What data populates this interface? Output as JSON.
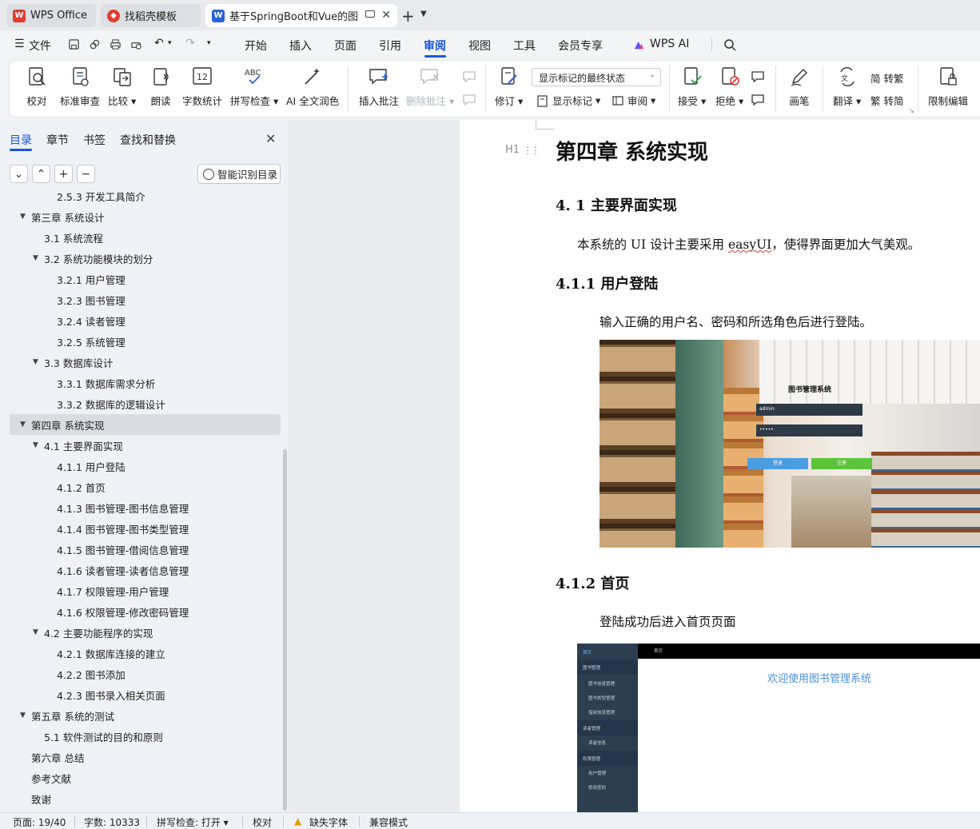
{
  "tabs": [
    {
      "label": "WPS Office"
    },
    {
      "label": "找稻壳模板"
    },
    {
      "label": "基于SpringBoot和Vue的图书"
    }
  ],
  "menu": {
    "file": "文件",
    "items": [
      "开始",
      "插入",
      "页面",
      "引用",
      "审阅",
      "视图",
      "工具",
      "会员专享"
    ],
    "active": "审阅",
    "ai": "WPS AI"
  },
  "ribbon": {
    "proofread": "校对",
    "standard_review": "标准审查",
    "compare": "比较",
    "read_aloud": "朗读",
    "word_count": "字数统计",
    "spell_check": "拼写检查",
    "ai_polish": "AI 全文润色",
    "insert_comment": "插入批注",
    "delete_comment": "删除批注",
    "revise": "修订",
    "view_mode": "显示标记的最终状态",
    "show_markup": "显示标记",
    "review_pane": "审阅",
    "accept": "接受",
    "reject": "拒绝",
    "pen": "画笔",
    "translate": "翻译",
    "to_traditional_a": "转繁",
    "to_simplified": "转简",
    "restrict_edit": "限制编辑",
    "word_count_icon_text": "12",
    "spell_icon_text": "ABC",
    "trad_a": "简",
    "trad_b": "繁"
  },
  "nav": {
    "tabs": [
      "目录",
      "章节",
      "书签",
      "查找和替换"
    ],
    "smart_toc": "智能识别目录",
    "toc": [
      {
        "label": "2.5.3 开发工具简介",
        "level": 3
      },
      {
        "label": "第三章  系统设计",
        "level": 1,
        "expanded": true
      },
      {
        "label": "3.1 系统流程",
        "level": 2
      },
      {
        "label": "3.2  系统功能模块的划分",
        "level": 2,
        "expanded": true
      },
      {
        "label": "3.2.1 用户管理",
        "level": 3
      },
      {
        "label": "3.2.3  图书管理",
        "level": 3
      },
      {
        "label": "3.2.4 读者管理",
        "level": 3
      },
      {
        "label": "3.2.5   系统管理",
        "level": 3
      },
      {
        "label": "3.3 数据库设计",
        "level": 2,
        "expanded": true
      },
      {
        "label": "3.3.1 数据库需求分析",
        "level": 3
      },
      {
        "label": "3.3.2 数据库的逻辑设计",
        "level": 3
      },
      {
        "label": "第四章  系统实现",
        "level": 1,
        "expanded": true,
        "selected": true
      },
      {
        "label": "4.1 主要界面实现",
        "level": 2,
        "expanded": true
      },
      {
        "label": "4.1.1 用户登陆",
        "level": 3
      },
      {
        "label": "4.1.2   首页",
        "level": 3
      },
      {
        "label": "4.1.3   图书管理-图书信息管理",
        "level": 3
      },
      {
        "label": "4.1.4 图书管理-图书类型管理",
        "level": 3
      },
      {
        "label": "4.1.5 图书管理-借阅信息管理",
        "level": 3
      },
      {
        "label": "4.1.6 读者管理-读者信息管理",
        "level": 3
      },
      {
        "label": "4.1.7 权限管理-用户管理",
        "level": 3
      },
      {
        "label": "4.1.6 权限管理-修改密码管理",
        "level": 3
      },
      {
        "label": "4.2 主要功能程序的实现",
        "level": 2,
        "expanded": true
      },
      {
        "label": "4.2.1  数据库连接的建立",
        "level": 3
      },
      {
        "label": "4.2.2 图书添加",
        "level": 3
      },
      {
        "label": "4.2.3 图书录入相关页面",
        "level": 3
      },
      {
        "label": "第五章  系统的测试",
        "level": 1,
        "expanded": true
      },
      {
        "label": "5.1    软件测试的目的和原则",
        "level": 2
      },
      {
        "label": "第六章    总结",
        "level": 1
      },
      {
        "label": "参考文献",
        "level": 1
      },
      {
        "label": "致谢",
        "level": 1
      }
    ]
  },
  "doc": {
    "heading_marker": "H1",
    "chapter_title": "第四章  系统实现",
    "section_41": "4. 1 主要界面实现",
    "p1_a": "本系统的 UI 设计主要采用 ",
    "p1_b": "easyUI",
    "p1_c": "，使得界面更加大气美观。",
    "section_411": "4.1.1 用户登陆",
    "p2": "输入正确的用户名、密码和所选角色后进行登陆。",
    "login": {
      "title": "图书管理系统",
      "username": "admin",
      "password": "•••••",
      "login_btn": "登录",
      "register_btn": "注册"
    },
    "section_412": "4.1.2   首页",
    "p3": "登陆成功后进入首页页面",
    "home": {
      "nav_home": "首页",
      "top_tab": "首页",
      "group1": "图书管理",
      "g1_items": [
        "图书信息管理",
        "图书类型管理",
        "借阅信息管理"
      ],
      "group2": "读者管理",
      "g2_items": [
        "读者信息"
      ],
      "group3": "权限管理",
      "g3_items": [
        "用户管理",
        "修改密码"
      ],
      "welcome": "欢迎使用图书管理系统"
    }
  },
  "status": {
    "page": "页面: 19/40",
    "words": "字数: 10333",
    "spell": "拼写检查: 打开",
    "proof": "校对",
    "missing_font": "缺失字体",
    "compat": "兼容模式"
  },
  "colors": {
    "accent": "#1a56db",
    "wps_red": "#e23a2f",
    "doc_blue": "#2b63d9"
  }
}
